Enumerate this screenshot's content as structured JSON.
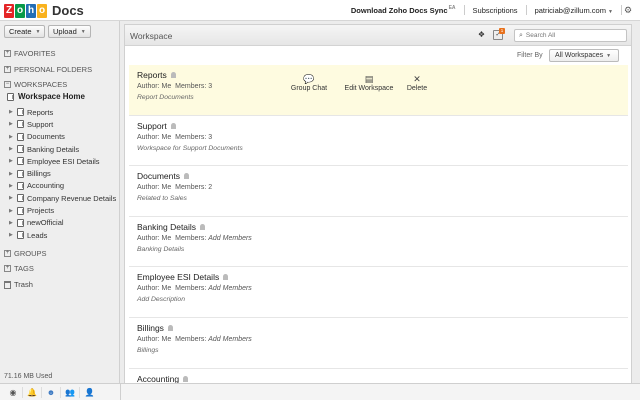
{
  "app": {
    "logo_letters": [
      {
        "ch": "Z",
        "color": "#e42527"
      },
      {
        "ch": "o",
        "color": "#089949"
      },
      {
        "ch": "h",
        "color": "#226db4"
      },
      {
        "ch": "o",
        "color": "#f9b21d"
      }
    ],
    "logo_text": "Docs"
  },
  "topbar": {
    "download_label": "Download Zoho Docs Sync",
    "ea_label": "EA",
    "subscriptions_label": "Subscriptions",
    "user_email": "patriciab@zillum.com"
  },
  "sidebar": {
    "create_label": "Create",
    "upload_label": "Upload",
    "favorites_label": "FAVORITES",
    "personal_folders_label": "PERSONAL FOLDERS",
    "workspaces_label": "WORKSPACES",
    "workspace_home_label": "Workspace Home",
    "workspaces": [
      "Reports",
      "Support",
      "Documents",
      "Banking Details",
      "Employee ESI Details",
      "Billings",
      "Accounting",
      "Company Revenue Details",
      "Projects",
      "newOfficial",
      "Leads"
    ],
    "groups_label": "GROUPS",
    "tags_label": "TAGS",
    "trash_label": "Trash",
    "storage_label": "71.16 MB Used"
  },
  "main": {
    "title": "Workspace",
    "search_placeholder": "Search All",
    "filter_label": "Filter By",
    "filter_value": "All Workspaces",
    "actions": {
      "group_chat": "Group Chat",
      "edit_workspace": "Edit Workspace",
      "delete": "Delete"
    },
    "rows": [
      {
        "name": "Reports",
        "author_label": "Author:",
        "author": "Me",
        "members_label": "Members:",
        "members": "3",
        "desc": "Report Documents"
      },
      {
        "name": "Support",
        "author_label": "Author:",
        "author": "Me",
        "members_label": "Members:",
        "members": "3",
        "desc": "Workspace for Support Documents"
      },
      {
        "name": "Documents",
        "author_label": "Author:",
        "author": "Me",
        "members_label": "Members:",
        "members": "2",
        "desc": "Related to Sales"
      },
      {
        "name": "Banking Details",
        "author_label": "Author:",
        "author": "Me",
        "members_label": "Members:",
        "members": "Add Members",
        "desc": "Banking Details"
      },
      {
        "name": "Employee ESI Details",
        "author_label": "Author:",
        "author": "Me",
        "members_label": "Members:",
        "members": "Add Members",
        "desc": "Add Description"
      },
      {
        "name": "Billings",
        "author_label": "Author:",
        "author": "Me",
        "members_label": "Members:",
        "members": "Add Members",
        "desc": "Billings"
      },
      {
        "name": "Accounting",
        "author_label": "",
        "author": "",
        "members_label": "",
        "members": "",
        "desc": ""
      }
    ]
  },
  "icons": {
    "dropbox": "dropbox-icon",
    "notifications": "notification-icon",
    "search": "search-icon",
    "gear": "gear-icon"
  },
  "colors": {
    "highlight_row": "#fefbe0",
    "badge": "#e8711c"
  }
}
